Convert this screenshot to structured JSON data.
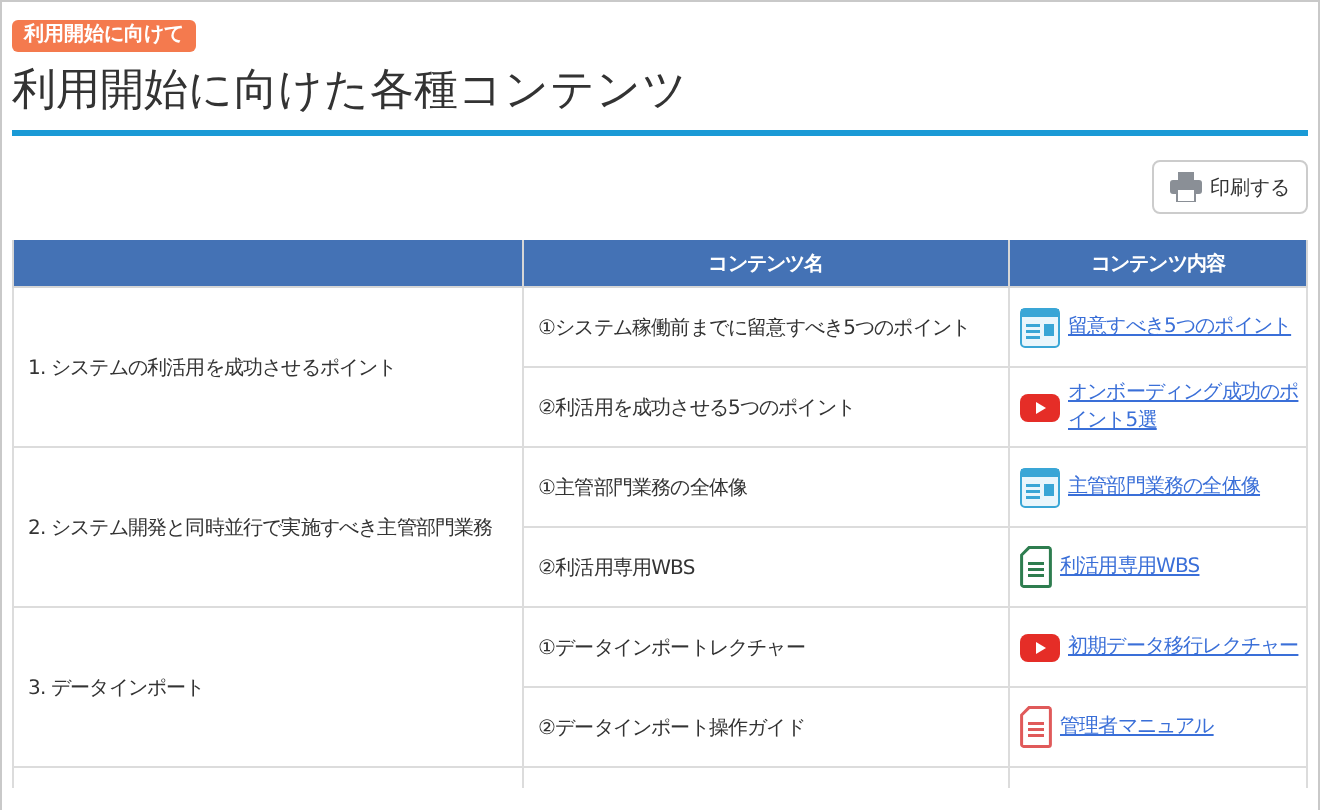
{
  "badge": "利用開始に向けて",
  "title": "利用開始に向けた各種コンテンツ",
  "print_button": "印刷する",
  "table": {
    "columns": [
      "コンテンツ名",
      "コンテンツ内容"
    ],
    "rows": [
      {
        "topic": "1.  システムの利活用を成功させるポイント",
        "items": [
          {
            "name": "①システム稼働前までに留意すべき5つのポイント",
            "link": "留意すべき5つのポイント",
            "kind": "doc"
          },
          {
            "name": "②利活用を成功させる5つのポイント",
            "link": "オンボーディング成功のポイント5選",
            "kind": "video"
          }
        ]
      },
      {
        "topic": "2.  システム開発と同時並行で実施すべき主管部門業務",
        "items": [
          {
            "name": "①主管部門業務の全体像",
            "link": "主管部門業務の全体像",
            "kind": "doc"
          },
          {
            "name": "②利活用専用WBS",
            "link": "利活用専用WBS",
            "kind": "sheet"
          }
        ]
      },
      {
        "topic": "3.  データインポート",
        "items": [
          {
            "name": "①データインポートレクチャー",
            "link": "初期データ移行レクチャー",
            "kind": "video"
          },
          {
            "name": "②データインポート操作ガイド",
            "link": "管理者マニュアル",
            "kind": "pdf"
          }
        ]
      }
    ]
  }
}
